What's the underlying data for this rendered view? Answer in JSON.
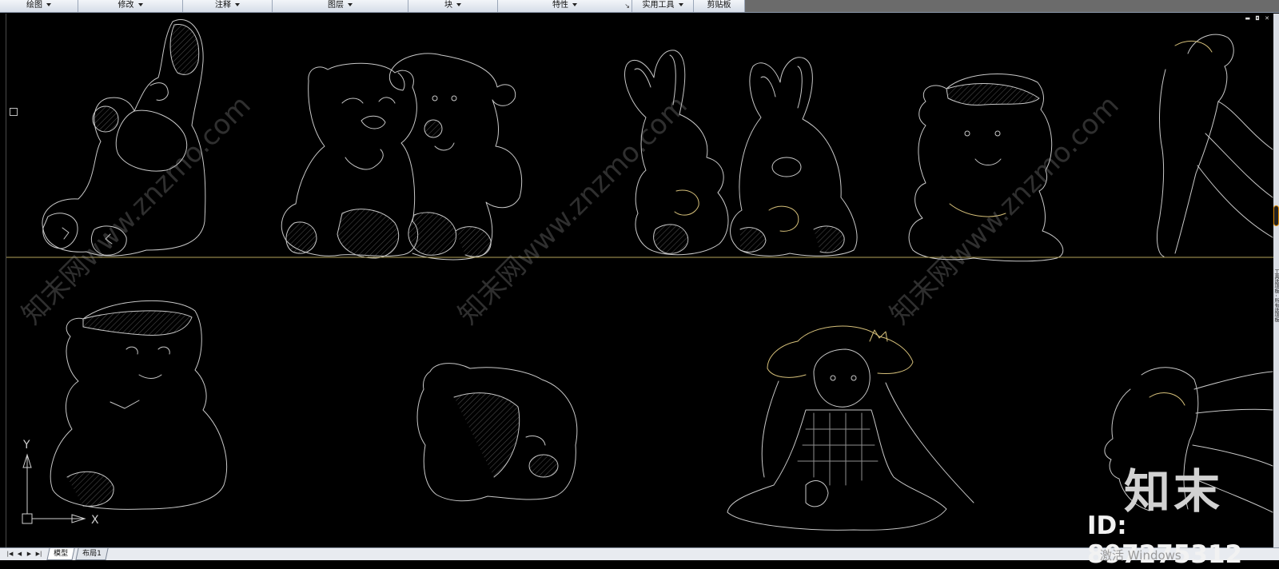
{
  "ribbon": {
    "panels": [
      {
        "label": "绘图",
        "dropdown": true
      },
      {
        "label": "修改",
        "dropdown": true
      },
      {
        "label": "注释",
        "dropdown": true
      },
      {
        "label": "图层",
        "dropdown": true
      },
      {
        "label": "块",
        "dropdown": true
      },
      {
        "label": "特性",
        "dropdown": true,
        "launcher": "↘"
      },
      {
        "label": "实用工具",
        "dropdown": true
      },
      {
        "label": "剪贴板",
        "dropdown": false
      }
    ]
  },
  "canvas": {
    "background": "#000000",
    "line_color": "#c8c8c8",
    "accent_line_color": "#d6c07a",
    "divider_color": "#b5a35a",
    "window_controls": "▬ ◘ ✕"
  },
  "ucs": {
    "x_label": "X",
    "y_label": "Y"
  },
  "layout_tabs": {
    "nav_buttons": [
      "|◀",
      "◀",
      "▶",
      "▶|"
    ],
    "tabs": [
      {
        "label": "模型",
        "active": true
      },
      {
        "label": "布局1",
        "active": false
      }
    ]
  },
  "palette_edge": {
    "label": "工具选项板 - 所有选项板"
  },
  "watermark": {
    "text": "知末网www.znzmo.com",
    "brand": "知末",
    "id_text": "ID: 897275312",
    "activation": "激活 Windows"
  }
}
